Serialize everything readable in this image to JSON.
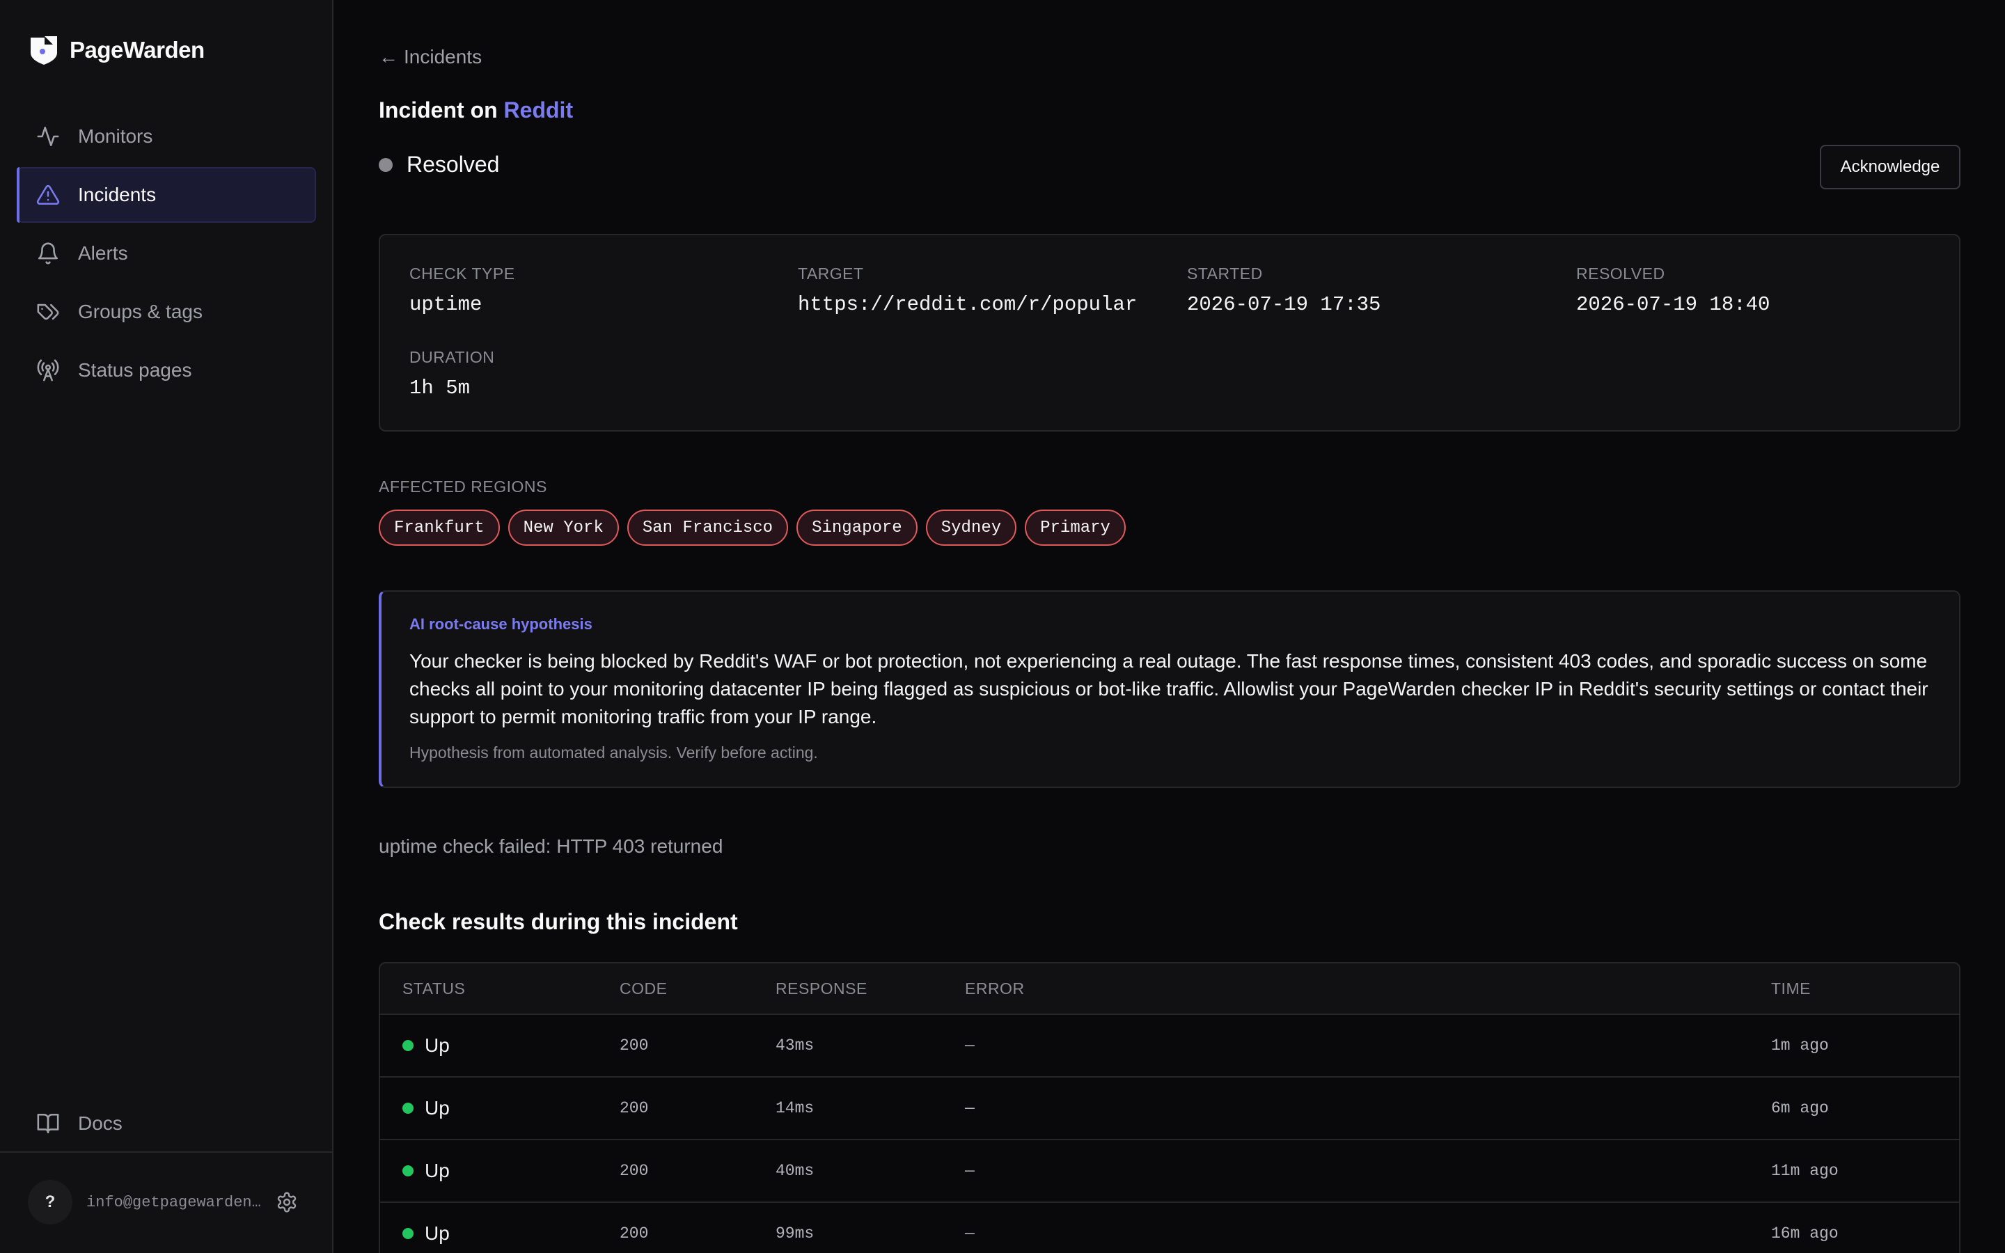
{
  "app": {
    "name": "PageWarden"
  },
  "sidebar": {
    "items": [
      {
        "label": "Monitors",
        "icon": "activity-icon"
      },
      {
        "label": "Incidents",
        "icon": "alert-triangle-icon",
        "active": true
      },
      {
        "label": "Alerts",
        "icon": "bell-icon"
      },
      {
        "label": "Groups & tags",
        "icon": "tags-icon"
      },
      {
        "label": "Status pages",
        "icon": "radio-tower-icon"
      }
    ],
    "docs_label": "Docs",
    "help_label": "?",
    "user_email": "info@getpagewarden.com"
  },
  "header": {
    "back_label": "Incidents",
    "title_prefix": "Incident on",
    "monitor_name": "Reddit",
    "status": "Resolved",
    "acknowledge_label": "Acknowledge"
  },
  "details": {
    "check_type_label": "CHECK TYPE",
    "check_type": "uptime",
    "target_label": "TARGET",
    "target": "https://reddit.com/r/popular",
    "started_label": "STARTED",
    "started": "2026-07-19 17:35",
    "resolved_label": "RESOLVED",
    "resolved": "2026-07-19 18:40",
    "duration_label": "DURATION",
    "duration": "1h 5m"
  },
  "regions": {
    "label": "AFFECTED REGIONS",
    "items": [
      "Frankfurt",
      "New York",
      "San Francisco",
      "Singapore",
      "Sydney",
      "Primary"
    ]
  },
  "ai": {
    "title": "AI root-cause hypothesis",
    "body": "Your checker is being blocked by Reddit's WAF or bot protection, not experiencing a real outage. The fast response times, consistent 403 codes, and sporadic success on some checks all point to your monitoring datacenter IP being flagged as suspicious or bot-like traffic. Allowlist your PageWarden checker IP in Reddit's security settings or contact their support to permit monitoring traffic from your IP range.",
    "note": "Hypothesis from automated analysis. Verify before acting."
  },
  "failure_message": "uptime check failed: HTTP 403 returned",
  "results": {
    "title": "Check results during this incident",
    "columns": [
      "STATUS",
      "CODE",
      "RESPONSE",
      "ERROR",
      "TIME"
    ],
    "rows": [
      {
        "status": "Up",
        "code": "200",
        "response": "43ms",
        "error": "—",
        "time": "1m ago"
      },
      {
        "status": "Up",
        "code": "200",
        "response": "14ms",
        "error": "—",
        "time": "6m ago"
      },
      {
        "status": "Up",
        "code": "200",
        "response": "40ms",
        "error": "—",
        "time": "11m ago"
      },
      {
        "status": "Up",
        "code": "200",
        "response": "99ms",
        "error": "—",
        "time": "16m ago"
      }
    ]
  },
  "colors": {
    "accent": "#6e6ee8",
    "link": "#7b7bf0",
    "status_up": "#22c55e",
    "status_resolved": "#8a8a90",
    "region_chip_border": "#e05a5a"
  }
}
